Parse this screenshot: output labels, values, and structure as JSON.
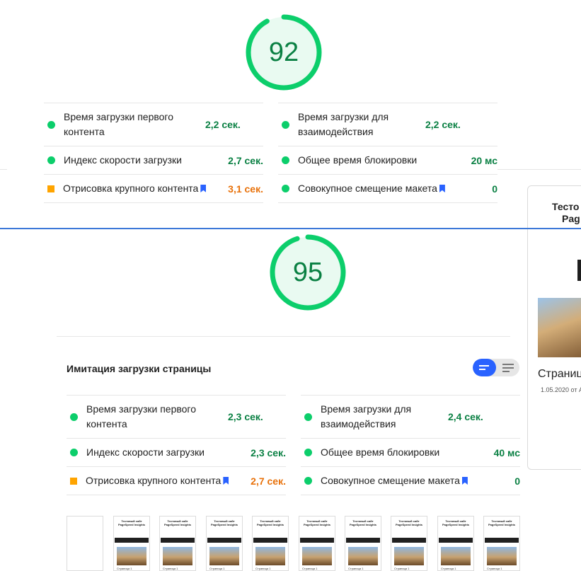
{
  "report1": {
    "score": "92",
    "score_fraction": 0.92,
    "metrics": [
      {
        "label": "Время загрузки первого контента",
        "value": "2,2 сек.",
        "status": "pass"
      },
      {
        "label": "Время загрузки для взаимодействия",
        "value": "2,2 сек.",
        "status": "pass"
      },
      {
        "label": "Индекс скорости загрузки",
        "value": "2,7 сек.",
        "status": "pass"
      },
      {
        "label": "Общее время блокировки",
        "value": "20 мс",
        "status": "pass"
      },
      {
        "label": "Отрисовка крупного контента",
        "value": "3,1 сек.",
        "status": "average"
      },
      {
        "label": "Совокупное смещение макета",
        "value": "0",
        "status": "pass"
      }
    ]
  },
  "report2": {
    "score": "95",
    "score_fraction": 0.95,
    "section_title": "Имитация загрузки страницы",
    "metrics": [
      {
        "label": "Время загрузки первого контента",
        "value": "2,3 сек.",
        "status": "pass"
      },
      {
        "label": "Время загрузки для взаимодействия",
        "value": "2,4 сек.",
        "status": "pass"
      },
      {
        "label": "Индекс скорости загрузки",
        "value": "2,3 сек.",
        "status": "pass"
      },
      {
        "label": "Общее время блокировки",
        "value": "40 мс",
        "status": "pass"
      },
      {
        "label": "Отрисовка крупного контента",
        "value": "2,7 сек.",
        "status": "average"
      },
      {
        "label": "Совокупное смещение макета",
        "value": "0",
        "status": "pass"
      }
    ],
    "filmstrip": {
      "frame_title": "Тестовый сайт PageSpeed Insights",
      "frame_caption": "Страница 1"
    }
  },
  "side_preview": {
    "title_line1": "Тесто",
    "title_line2": "Pag",
    "page_title": "Страница",
    "date_text": "1.05.2020 от А"
  },
  "colors": {
    "pass": "#0cce6b",
    "pass_text": "#0a8043",
    "average": "#ffa400",
    "average_text": "#e8710a",
    "accent": "#2962ff",
    "gauge_bg": "#e9faf1"
  }
}
